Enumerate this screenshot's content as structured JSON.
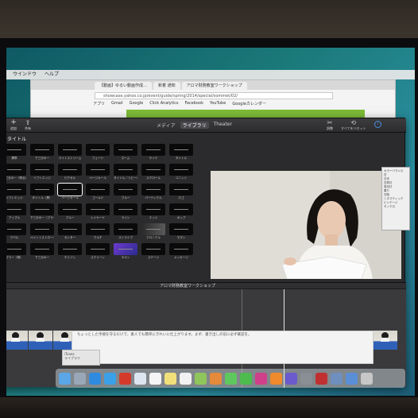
{
  "browser": {
    "tabs": [
      "【動画】ゆるい動画作成…",
      "新着 通知",
      "アロマ財務教室ワークショップ"
    ],
    "url": "showcase.yahoo.co.jp/event/guide/spring/2014/special/sommet/02/",
    "bookmarks": [
      "アプリ",
      "Gmail",
      "Google",
      "Click Analytics",
      "Facebook",
      "YouTube",
      "Googleカレンダー"
    ],
    "document_text": "ちょっとした手順を守るだけで、素人でも簡単にきれいに仕上がります。まず、書き出しの前に必ず確認を。"
  },
  "menubar": {
    "items": [
      "",
      "ウインドウ",
      "ヘルプ"
    ]
  },
  "imovie": {
    "toolbar": {
      "add_label": "追加",
      "add_glyph": "+",
      "share_label": "共有",
      "share_glyph": "⇪",
      "mode_tabs": [
        "メディア",
        "ライブラリ",
        "Theater"
      ],
      "adjust_label": "調整",
      "adjust_glyph": "✂",
      "reset_label": "すべてをリセット",
      "reset_glyph": "⟲",
      "info_glyph": "i"
    },
    "section_label": "タイトル",
    "titles": [
      "標準",
      "下三分の一",
      "ライトストリーム",
      "フェード",
      "ズーム",
      "サイド",
      "タイトル",
      "下三分の一（明るい）",
      "ソフトエッジ",
      "ピクセル",
      "ページカール",
      "タイトル／リビール",
      "スクロール",
      "ユニット",
      "ソフトエッジ",
      "タイトル（黒）",
      "ページカール",
      "ゴールド",
      "ブルー",
      "パーティクル",
      "ロゴ",
      "アップル",
      "下三分の一（ブラー）",
      "ブルー",
      "レイヤード",
      "ライン",
      "エッジ",
      "ポップ",
      "ラベル",
      "ペイントストローク",
      "センター",
      "マルチ",
      "ストライプ",
      "クロニクル",
      "モダン",
      "ブラー（明）",
      "下三分の一",
      "ホリゾン",
      "スクリーン",
      "ネオン",
      "ステージ",
      "メッセージ"
    ],
    "project_title": "アロマ財務教室ワークショップ",
    "clip_count": 16,
    "right_panel": [
      "カラーバランス",
      "白",
      "日光",
      "白熱灯",
      "蛍光灯",
      "雲り",
      "日陰",
      "シネマティック",
      "ビンテージ",
      "モノクロ"
    ]
  },
  "itunes_card": {
    "title": "iTunes",
    "subtitle": "ライブラリ"
  },
  "dock": {
    "icons": [
      {
        "name": "finder-icon",
        "color": "#5aa6e6"
      },
      {
        "name": "launchpad-icon",
        "color": "#9aa7b8"
      },
      {
        "name": "app-store-icon",
        "color": "#2f8be0"
      },
      {
        "name": "safari-icon",
        "color": "#3aa0e8"
      },
      {
        "name": "chrome-icon",
        "color": "#d43a2a"
      },
      {
        "name": "mail-icon",
        "color": "#dde6f0"
      },
      {
        "name": "calendar-icon",
        "color": "#f5f5f5"
      },
      {
        "name": "notes-icon",
        "color": "#f0e07a"
      },
      {
        "name": "reminders-icon",
        "color": "#f2f2f2"
      },
      {
        "name": "maps-icon",
        "color": "#8fc65c"
      },
      {
        "name": "photos-icon",
        "color": "#e48a3a"
      },
      {
        "name": "messages-icon",
        "color": "#5ec85e"
      },
      {
        "name": "facetime-icon",
        "color": "#4dbb4d"
      },
      {
        "name": "itunes-icon",
        "color": "#d03f8a"
      },
      {
        "name": "ibooks-icon",
        "color": "#f08a2c"
      },
      {
        "name": "imovie-icon",
        "color": "#6a5acd"
      },
      {
        "name": "system-preferences-icon",
        "color": "#8a8f96"
      },
      {
        "name": "photo-booth-icon",
        "color": "#c03030"
      },
      {
        "name": "preview-icon",
        "color": "#6f8fbf"
      },
      {
        "name": "downloads-icon",
        "color": "#5a8fd8"
      },
      {
        "name": "trash-icon",
        "color": "#c7c7c7"
      }
    ]
  }
}
